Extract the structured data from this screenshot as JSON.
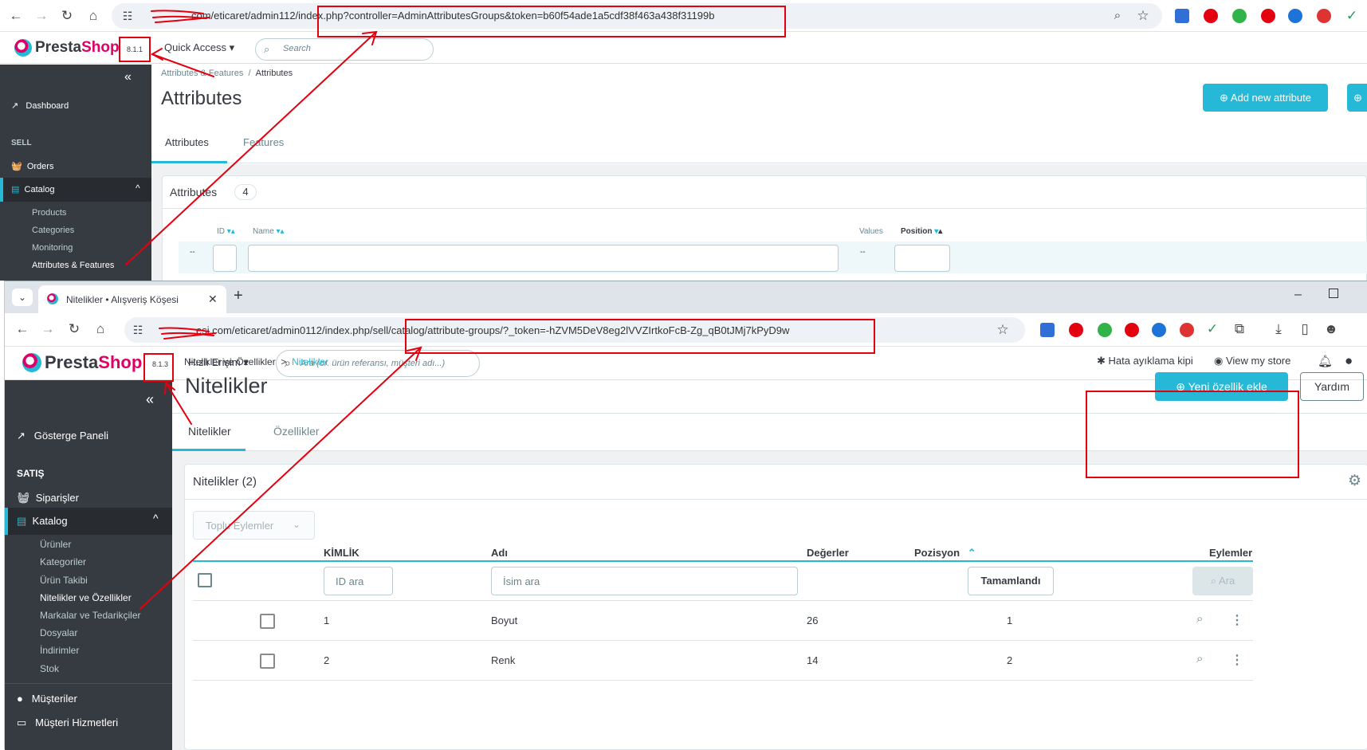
{
  "top": {
    "url": "com/eticaret/admin112/index.php?controller=AdminAttributesGroups&token=b60f54ade1a5cdf38f463a438f31199b",
    "version": "8.1.1",
    "logo": {
      "pre": "Presta",
      "post": "Shop"
    },
    "quick_access": "Quick Access",
    "search_placeholder": "Search",
    "breadcrumb": {
      "parent": "Attributes & Features",
      "sep": "/",
      "current": "Attributes"
    },
    "page_title": "Attributes",
    "add_button": "Add new attribute",
    "tabs": [
      "Attributes",
      "Features"
    ],
    "card_title": "Attributes",
    "card_count": "4",
    "columns": {
      "id": "ID",
      "name": "Name",
      "values": "Values",
      "position": "Position"
    },
    "filter_dash": "--",
    "sidebar": {
      "dashboard": "Dashboard",
      "sell_header": "SELL",
      "orders": "Orders",
      "catalog": "Catalog",
      "sub": [
        "Products",
        "Categories",
        "Monitoring",
        "Attributes & Features"
      ]
    }
  },
  "bottom": {
    "tab_title": "Nitelikler • Alışveriş Köşesi",
    "new_tab": "+",
    "url": "esi.com/eticaret/admin0112/index.php/sell/catalog/attribute-groups/?_token=-hZVM5DeV8eg2lVVZIrtkoFcB-Zg_qB0tJMj7kPyD9w",
    "version": "8.1.3",
    "logo": {
      "pre": "Presta",
      "post": "Shop"
    },
    "quick_access": "Hızlı Erişim",
    "search_placeholder": "Ara (ör. ürün referansı, müşteri adı...)",
    "debug_mode": "Hata ayıklama kipi",
    "view_store": "View my store",
    "breadcrumb": {
      "parent": "Nitelikler ve Özellikler",
      "sep": ">",
      "current": "Nitelikler"
    },
    "page_title": "Nitelikler",
    "add_button": "Yeni özellik ekle",
    "help_button": "Yardım",
    "tabs": [
      "Nitelikler",
      "Özellikler"
    ],
    "card_title": "Nitelikler (2)",
    "bulk_actions": "Toplu Eylemler",
    "columns": {
      "id": "KİMLİK",
      "name": "Adı",
      "values": "Değerler",
      "position": "Pozisyon",
      "actions": "Eylemler"
    },
    "filters": {
      "id_placeholder": "ID ara",
      "name_placeholder": "İsim ara",
      "done": "Tamamlandı",
      "search": "Ara"
    },
    "rows": [
      {
        "id": "1",
        "name": "Boyut",
        "values": "26",
        "position": "1"
      },
      {
        "id": "2",
        "name": "Renk",
        "values": "14",
        "position": "2"
      }
    ],
    "sidebar": {
      "dashboard": "Gösterge Paneli",
      "sell_header": "SATIŞ",
      "orders": "Siparişler",
      "catalog": "Katalog",
      "sub": [
        "Ürünler",
        "Kategoriler",
        "Ürün Takibi",
        "Nitelikler ve Özellikler",
        "Markalar ve Tedarikçiler",
        "Dosyalar",
        "İndirimler",
        "Stok"
      ],
      "customers": "Müşteriler",
      "customer_service": "Müşteri Hizmetleri"
    }
  },
  "colors": {
    "accent": "#25b9d7",
    "brand": "#df0067",
    "annotation": "#e3000f",
    "sidebar": "#363a41"
  }
}
